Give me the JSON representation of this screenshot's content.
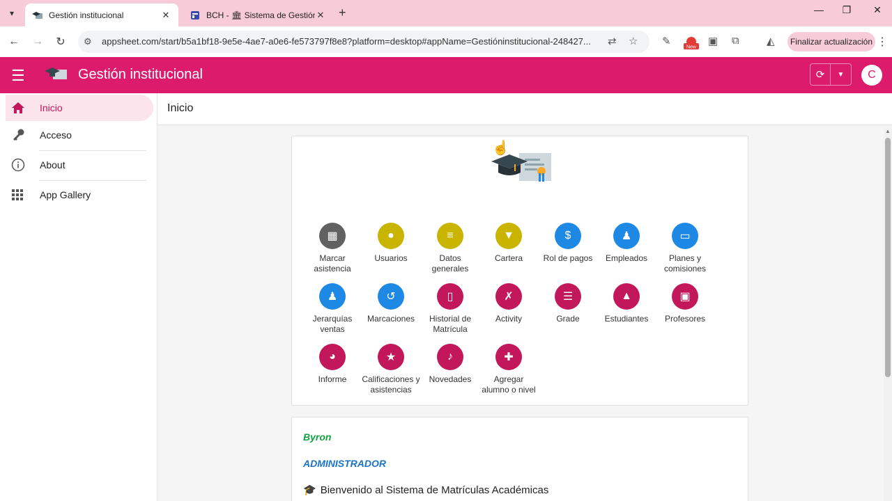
{
  "browser": {
    "tabs": [
      {
        "title": "Gestión institucional",
        "close": "✕"
      },
      {
        "title": "BCH - 🏛 Sistema de Gestión p",
        "close": "✕"
      }
    ],
    "new_tab": "+",
    "url": "appsheet.com/start/b5a1bf18-9e5e-4ae7-a0e6-fe573797f8e8?platform=desktop#appName=Gestióninstitucional-248427...",
    "update_button": "Finalizar actualización",
    "new_badge": "New"
  },
  "app": {
    "title": "Gestión institucional",
    "avatar_letter": "C",
    "brand_color": "#dd1b6d"
  },
  "sidebar": {
    "items": [
      {
        "label": "Inicio",
        "icon": "home-icon"
      },
      {
        "label": "Acceso",
        "icon": "key-icon"
      },
      {
        "label": "About",
        "icon": "info-icon"
      },
      {
        "label": "App Gallery",
        "icon": "grid-icon"
      }
    ]
  },
  "main": {
    "page_title": "Inicio",
    "grid": [
      {
        "label": "Marcar asistencia",
        "color": "#616161",
        "icon": "qr-icon"
      },
      {
        "label": "Usuarios",
        "color": "#c9b400",
        "icon": "user-icon"
      },
      {
        "label": "Datos generales",
        "color": "#c9b400",
        "icon": "database-icon"
      },
      {
        "label": "Cartera",
        "color": "#c9b400",
        "icon": "funnel-money-icon"
      },
      {
        "label": "Rol de pagos",
        "color": "#1e88e5",
        "icon": "invoice-icon"
      },
      {
        "label": "Empleados",
        "color": "#1e88e5",
        "icon": "employee-icon"
      },
      {
        "label": "Planes y comisiones",
        "color": "#1e88e5",
        "icon": "cash-icon"
      },
      {
        "label": "Jerarquías ventas",
        "color": "#1e88e5",
        "icon": "manager-icon"
      },
      {
        "label": "Marcaciones",
        "color": "#1e88e5",
        "icon": "history-icon"
      },
      {
        "label": "Historial de Matrícula",
        "color": "#c2185b",
        "icon": "book-icon"
      },
      {
        "label": "Activity",
        "color": "#c2185b",
        "icon": "running-icon"
      },
      {
        "label": "Grade",
        "color": "#c2185b",
        "icon": "list-icon"
      },
      {
        "label": "Estudiantes",
        "color": "#c2185b",
        "icon": "graduation-cap-icon"
      },
      {
        "label": "Profesores",
        "color": "#c2185b",
        "icon": "teacher-icon"
      },
      {
        "label": "Informe",
        "color": "#c2185b",
        "icon": "pie-chart-icon"
      },
      {
        "label": "Calificaciones y asistencias",
        "color": "#c2185b",
        "icon": "star-icon"
      },
      {
        "label": "Novedades",
        "color": "#c2185b",
        "icon": "bell-icon"
      },
      {
        "label": "Agregar alumno o nivel",
        "color": "#c2185b",
        "icon": "add-user-icon"
      }
    ],
    "user_name": "Byron",
    "user_role": "ADMINISTRADOR",
    "welcome": "Bienvenido al Sistema de Matrículas Académicas"
  }
}
